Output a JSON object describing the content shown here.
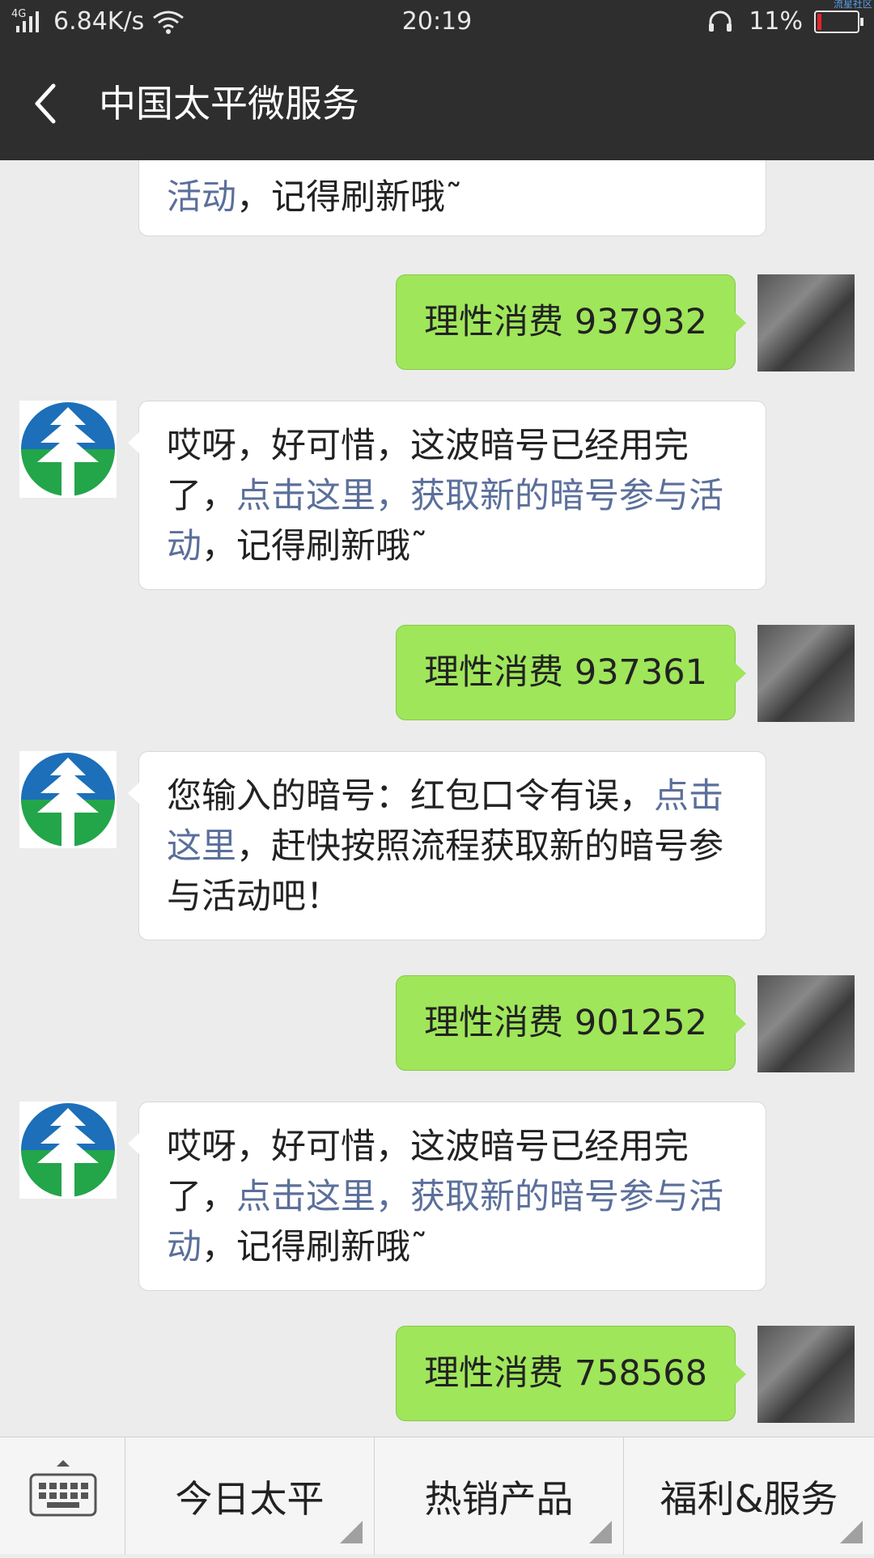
{
  "status_bar": {
    "network_type": "4G",
    "speed": "6.84K/s",
    "time": "20:19",
    "battery_percent": "11%",
    "battery_level": 0.11,
    "watermark": "流星社区"
  },
  "header": {
    "title": "中国太平微服务"
  },
  "messages": {
    "m0": {
      "link": "活动",
      "text": "，记得刷新哦˜"
    },
    "m1": {
      "text": "理性消费 937932"
    },
    "m2": {
      "text1": "哎呀，好可惜，这波暗号已经用完了，",
      "link1": "点击这里，获取新的暗号参与活动",
      "text2": "，记得刷新哦˜"
    },
    "m3": {
      "text": "理性消费 937361"
    },
    "m4": {
      "text1": "您输入的暗号：红包口令有误，",
      "link1": "点击这里",
      "text2": "，赶快按照流程获取新的暗号参与活动吧！"
    },
    "m5": {
      "text": "理性消费 901252"
    },
    "m6": {
      "text1": "哎呀，好可惜，这波暗号已经用完了，",
      "link1": "点击这里，获取新的暗号参与活动",
      "text2": "，记得刷新哦˜"
    },
    "m7": {
      "text": "理性消费 758568"
    }
  },
  "bottom_menu": {
    "items": [
      {
        "label": "今日太平"
      },
      {
        "label": "热销产品"
      },
      {
        "label": "福利&服务"
      }
    ]
  },
  "icons": {
    "back": "chevron-left-icon",
    "keyboard": "keyboard-icon",
    "bot_avatar": "china-taiping-logo",
    "user_avatar": "user-photo"
  },
  "colors": {
    "header_bg": "#2e2e2e",
    "chat_bg": "#ececec",
    "out_bubble": "#9fe65a",
    "in_bubble": "#ffffff",
    "link": "#5b6f9a",
    "logo_blue": "#1c6fb8",
    "logo_green": "#23a54a"
  }
}
